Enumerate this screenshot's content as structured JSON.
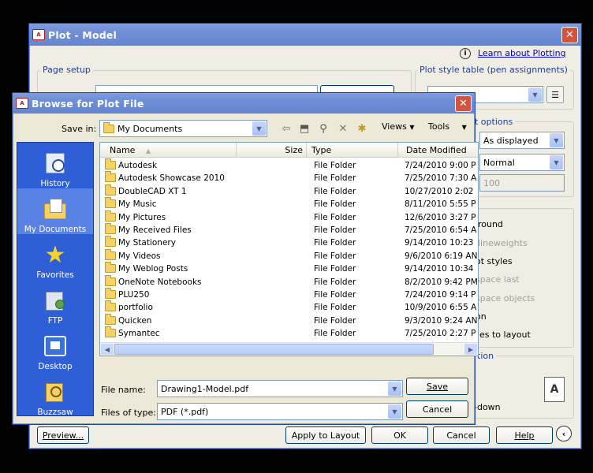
{
  "plot_dialog": {
    "title": "Plot - Model",
    "learn_link": "Learn about Plotting",
    "page_setup_label": "Page setup",
    "plot_style_label": "Plot style table (pen assignments)",
    "options_partial": "t options",
    "shaded_value": "As displayed",
    "quality_value": "Normal",
    "dpi_value": "100",
    "checkbox_fragments": [
      "ground",
      "lineweights",
      "ot styles",
      "space last",
      "space objects",
      "on",
      "ges to layout"
    ],
    "orientation_partial": "tion",
    "orientation_fragment": "-down",
    "buttons": {
      "preview": "Preview...",
      "apply": "Apply to Layout",
      "ok": "OK",
      "cancel": "Cancel",
      "help": "Help"
    }
  },
  "browse_dialog": {
    "title": "Browse for Plot File",
    "save_in_label": "Save in:",
    "save_in_value": "My Documents",
    "views_label": "Views",
    "tools_label": "Tools",
    "places": [
      {
        "label": "History",
        "icon": "history-icon"
      },
      {
        "label": "My Documents",
        "icon": "my-documents-icon"
      },
      {
        "label": "Favorites",
        "icon": "favorites-icon"
      },
      {
        "label": "FTP",
        "icon": "ftp-icon"
      },
      {
        "label": "Desktop",
        "icon": "desktop-icon"
      },
      {
        "label": "Buzzsaw",
        "icon": "buzzsaw-icon"
      }
    ],
    "columns": {
      "name": "Name",
      "size": "Size",
      "type": "Type",
      "date": "Date Modified"
    },
    "files": [
      {
        "name": "Autodesk",
        "type": "File Folder",
        "date": "7/24/2010 9:00 P"
      },
      {
        "name": "Autodesk Showcase 2010",
        "type": "File Folder",
        "date": "7/25/2010 7:30 A"
      },
      {
        "name": "DoubleCAD XT 1",
        "type": "File Folder",
        "date": "10/27/2010 2:02"
      },
      {
        "name": "My Music",
        "type": "File Folder",
        "date": "8/11/2010 5:55 P"
      },
      {
        "name": "My Pictures",
        "type": "File Folder",
        "date": "12/6/2010 3:27 P"
      },
      {
        "name": "My Received Files",
        "type": "File Folder",
        "date": "7/25/2010 6:54 A"
      },
      {
        "name": "My Stationery",
        "type": "File Folder",
        "date": "9/14/2010 10:23"
      },
      {
        "name": "My Videos",
        "type": "File Folder",
        "date": "9/6/2010 6:19 AN"
      },
      {
        "name": "My Weblog Posts",
        "type": "File Folder",
        "date": "9/14/2010 10:34"
      },
      {
        "name": "OneNote Notebooks",
        "type": "File Folder",
        "date": "8/2/2010 9:42 PM"
      },
      {
        "name": "PLU250",
        "type": "File Folder",
        "date": "7/24/2010 9:14 P"
      },
      {
        "name": "portfolio",
        "type": "File Folder",
        "date": "10/9/2010 6:55 A"
      },
      {
        "name": "Quicken",
        "type": "File Folder",
        "date": "9/3/2010 9:24 AN"
      },
      {
        "name": "Symantec",
        "type": "File Folder",
        "date": "7/25/2010 2:27 P"
      }
    ],
    "file_name_label": "File name:",
    "file_name_value": "Drawing1-Model.pdf",
    "file_type_label": "Files of type:",
    "file_type_value": "PDF (*.pdf)",
    "save_label": "Save",
    "cancel_label": "Cancel"
  },
  "colors": {
    "title_bar": "#6f8ed6",
    "close_button": "#d2533f",
    "places_bar": "#2f5fd6",
    "dialog_bg": "#f0eee4",
    "group_label": "#1e3c9a",
    "link": "#0000cc"
  }
}
